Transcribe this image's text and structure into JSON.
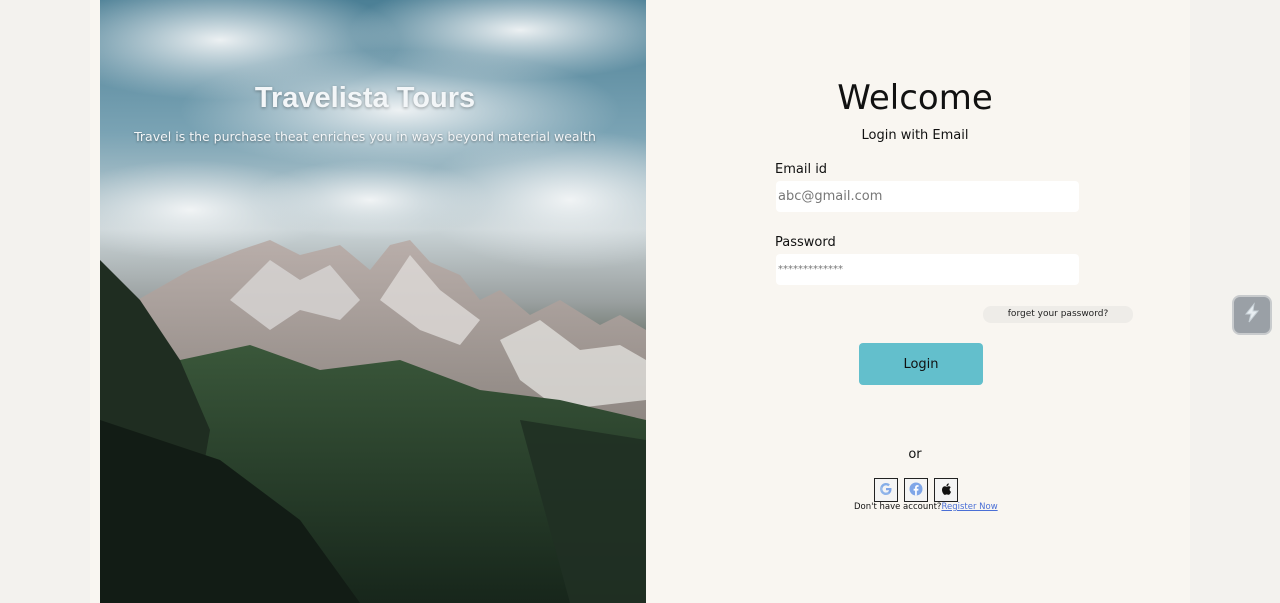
{
  "hero": {
    "title": "Travelista Tours",
    "tagline": "Travel is the purchase theat enriches you in ways beyond material wealth"
  },
  "login": {
    "welcome": "Welcome",
    "subtitle": "Login with Email",
    "email_label": "Email id",
    "email_placeholder": "abc@gmail.com",
    "password_label": "Password",
    "password_placeholder": "*************",
    "forgot_label": "forget your password?",
    "login_button": "Login",
    "or_text": "or",
    "register_prompt": "Don't have account?",
    "register_link": "Register Now"
  },
  "social": [
    {
      "icon": "google-icon"
    },
    {
      "icon": "facebook-icon"
    },
    {
      "icon": "apple-icon"
    }
  ],
  "colors": {
    "accent": "#63bfcc",
    "panel_bg": "#f9f6f1",
    "link": "#4a6fd6"
  }
}
